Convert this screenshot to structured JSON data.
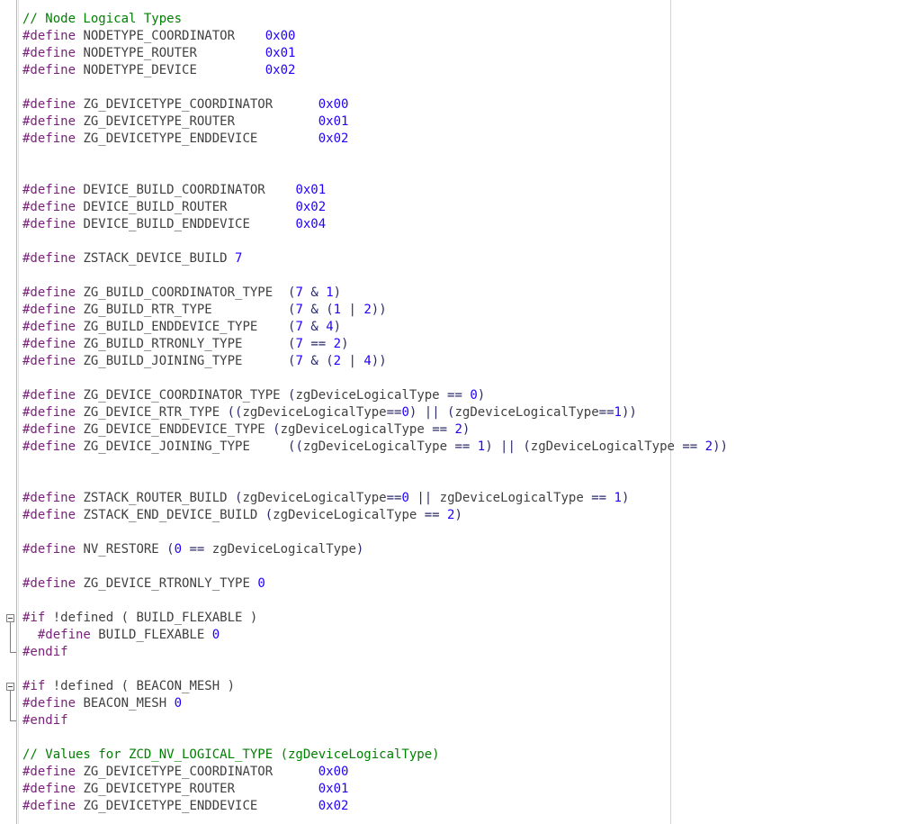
{
  "lines": [
    [
      [
        "// Node Logical Types",
        "cmt"
      ]
    ],
    [
      [
        "#define",
        "kw"
      ],
      [
        " NODETYPE_COORDINATOR    ",
        "plain"
      ],
      [
        "0x00",
        "num"
      ]
    ],
    [
      [
        "#define",
        "kw"
      ],
      [
        " NODETYPE_ROUTER         ",
        "plain"
      ],
      [
        "0x01",
        "num"
      ]
    ],
    [
      [
        "#define",
        "kw"
      ],
      [
        " NODETYPE_DEVICE         ",
        "plain"
      ],
      [
        "0x02",
        "num"
      ]
    ],
    [],
    [
      [
        "#define",
        "kw"
      ],
      [
        " ZG_DEVICETYPE_COORDINATOR      ",
        "plain"
      ],
      [
        "0x00",
        "num"
      ]
    ],
    [
      [
        "#define",
        "kw"
      ],
      [
        " ZG_DEVICETYPE_ROUTER           ",
        "plain"
      ],
      [
        "0x01",
        "num"
      ]
    ],
    [
      [
        "#define",
        "kw"
      ],
      [
        " ZG_DEVICETYPE_ENDDEVICE        ",
        "plain"
      ],
      [
        "0x02",
        "num"
      ]
    ],
    [],
    [],
    [
      [
        "#define",
        "kw"
      ],
      [
        " DEVICE_BUILD_COORDINATOR    ",
        "plain"
      ],
      [
        "0x01",
        "num"
      ]
    ],
    [
      [
        "#define",
        "kw"
      ],
      [
        " DEVICE_BUILD_ROUTER         ",
        "plain"
      ],
      [
        "0x02",
        "num"
      ]
    ],
    [
      [
        "#define",
        "kw"
      ],
      [
        " DEVICE_BUILD_ENDDEVICE      ",
        "plain"
      ],
      [
        "0x04",
        "num"
      ]
    ],
    [],
    [
      [
        "#define",
        "kw"
      ],
      [
        " ZSTACK_DEVICE_BUILD ",
        "plain"
      ],
      [
        "7",
        "num"
      ]
    ],
    [],
    [
      [
        "#define",
        "kw"
      ],
      [
        " ZG_BUILD_COORDINATOR_TYPE  ",
        "plain"
      ],
      [
        "(",
        "op"
      ],
      [
        "7",
        "num"
      ],
      [
        " & ",
        "op"
      ],
      [
        "1",
        "num"
      ],
      [
        ")",
        "op"
      ]
    ],
    [
      [
        "#define",
        "kw"
      ],
      [
        " ZG_BUILD_RTR_TYPE          ",
        "plain"
      ],
      [
        "(",
        "op"
      ],
      [
        "7",
        "num"
      ],
      [
        " & (",
        "op"
      ],
      [
        "1",
        "num"
      ],
      [
        " | ",
        "op"
      ],
      [
        "2",
        "num"
      ],
      [
        "))",
        "op"
      ]
    ],
    [
      [
        "#define",
        "kw"
      ],
      [
        " ZG_BUILD_ENDDEVICE_TYPE    ",
        "plain"
      ],
      [
        "(",
        "op"
      ],
      [
        "7",
        "num"
      ],
      [
        " & ",
        "op"
      ],
      [
        "4",
        "num"
      ],
      [
        ")",
        "op"
      ]
    ],
    [
      [
        "#define",
        "kw"
      ],
      [
        " ZG_BUILD_RTRONLY_TYPE      ",
        "plain"
      ],
      [
        "(",
        "op"
      ],
      [
        "7",
        "num"
      ],
      [
        " == ",
        "op"
      ],
      [
        "2",
        "num"
      ],
      [
        ")",
        "op"
      ]
    ],
    [
      [
        "#define",
        "kw"
      ],
      [
        " ZG_BUILD_JOINING_TYPE      ",
        "plain"
      ],
      [
        "(",
        "op"
      ],
      [
        "7",
        "num"
      ],
      [
        " & (",
        "op"
      ],
      [
        "2",
        "num"
      ],
      [
        " | ",
        "op"
      ],
      [
        "4",
        "num"
      ],
      [
        "))",
        "op"
      ]
    ],
    [],
    [
      [
        "#define",
        "kw"
      ],
      [
        " ZG_DEVICE_COORDINATOR_TYPE ",
        "plain"
      ],
      [
        "(",
        "op"
      ],
      [
        "zgDeviceLogicalType",
        "plain"
      ],
      [
        " == ",
        "op"
      ],
      [
        "0",
        "num"
      ],
      [
        ")",
        "op"
      ]
    ],
    [
      [
        "#define",
        "kw"
      ],
      [
        " ZG_DEVICE_RTR_TYPE ",
        "plain"
      ],
      [
        "((",
        "op"
      ],
      [
        "zgDeviceLogicalType",
        "plain"
      ],
      [
        "==",
        "op"
      ],
      [
        "0",
        "num"
      ],
      [
        ") || (",
        "op"
      ],
      [
        "zgDeviceLogicalType",
        "plain"
      ],
      [
        "==",
        "op"
      ],
      [
        "1",
        "num"
      ],
      [
        "))",
        "op"
      ]
    ],
    [
      [
        "#define",
        "kw"
      ],
      [
        " ZG_DEVICE_ENDDEVICE_TYPE ",
        "plain"
      ],
      [
        "(",
        "op"
      ],
      [
        "zgDeviceLogicalType",
        "plain"
      ],
      [
        " == ",
        "op"
      ],
      [
        "2",
        "num"
      ],
      [
        ")",
        "op"
      ]
    ],
    [
      [
        "#define",
        "kw"
      ],
      [
        " ZG_DEVICE_JOINING_TYPE     ",
        "plain"
      ],
      [
        "((",
        "op"
      ],
      [
        "zgDeviceLogicalType",
        "plain"
      ],
      [
        " == ",
        "op"
      ],
      [
        "1",
        "num"
      ],
      [
        ") || (",
        "op"
      ],
      [
        "zgDeviceLogicalType",
        "plain"
      ],
      [
        " == ",
        "op"
      ],
      [
        "2",
        "num"
      ],
      [
        "))",
        "op"
      ]
    ],
    [],
    [],
    [
      [
        "#define",
        "kw"
      ],
      [
        " ZSTACK_ROUTER_BUILD ",
        "plain"
      ],
      [
        "(",
        "op"
      ],
      [
        "zgDeviceLogicalType",
        "plain"
      ],
      [
        "==",
        "op"
      ],
      [
        "0",
        "num"
      ],
      [
        " || ",
        "op"
      ],
      [
        "zgDeviceLogicalType",
        "plain"
      ],
      [
        " == ",
        "op"
      ],
      [
        "1",
        "num"
      ],
      [
        ")",
        "op"
      ]
    ],
    [
      [
        "#define",
        "kw"
      ],
      [
        " ZSTACK_END_DEVICE_BUILD ",
        "plain"
      ],
      [
        "(",
        "op"
      ],
      [
        "zgDeviceLogicalType",
        "plain"
      ],
      [
        " == ",
        "op"
      ],
      [
        "2",
        "num"
      ],
      [
        ")",
        "op"
      ]
    ],
    [],
    [
      [
        "#define",
        "kw"
      ],
      [
        " NV_RESTORE ",
        "plain"
      ],
      [
        "(",
        "op"
      ],
      [
        "0",
        "num"
      ],
      [
        " == ",
        "op"
      ],
      [
        "zgDeviceLogicalType",
        "plain"
      ],
      [
        ")",
        "op"
      ]
    ],
    [],
    [
      [
        "#define",
        "kw"
      ],
      [
        " ZG_DEVICE_RTRONLY_TYPE ",
        "plain"
      ],
      [
        "0",
        "num"
      ]
    ],
    [],
    [
      [
        "#if",
        "kw"
      ],
      [
        " !defined ( BUILD_FLEXABLE )",
        "plain"
      ]
    ],
    [
      [
        "  #define",
        "kw"
      ],
      [
        " BUILD_FLEXABLE ",
        "plain"
      ],
      [
        "0",
        "num"
      ]
    ],
    [
      [
        "#endif",
        "kw"
      ]
    ],
    [],
    [
      [
        "#if",
        "kw"
      ],
      [
        " !defined ( BEACON_MESH )",
        "plain"
      ]
    ],
    [
      [
        "#define",
        "kw"
      ],
      [
        " BEACON_MESH ",
        "plain"
      ],
      [
        "0",
        "num"
      ]
    ],
    [
      [
        "#endif",
        "kw"
      ]
    ],
    [],
    [
      [
        "// Values for ZCD_NV_LOGICAL_TYPE (zgDeviceLogicalType)",
        "cmt"
      ]
    ],
    [
      [
        "#define",
        "kw"
      ],
      [
        " ZG_DEVICETYPE_COORDINATOR      ",
        "plain"
      ],
      [
        "0x00",
        "num"
      ]
    ],
    [
      [
        "#define",
        "kw"
      ],
      [
        " ZG_DEVICETYPE_ROUTER           ",
        "plain"
      ],
      [
        "0x01",
        "num"
      ]
    ],
    [
      [
        "#define",
        "kw"
      ],
      [
        " ZG_DEVICETYPE_ENDDEVICE        ",
        "plain"
      ],
      [
        "0x02",
        "num"
      ]
    ]
  ]
}
